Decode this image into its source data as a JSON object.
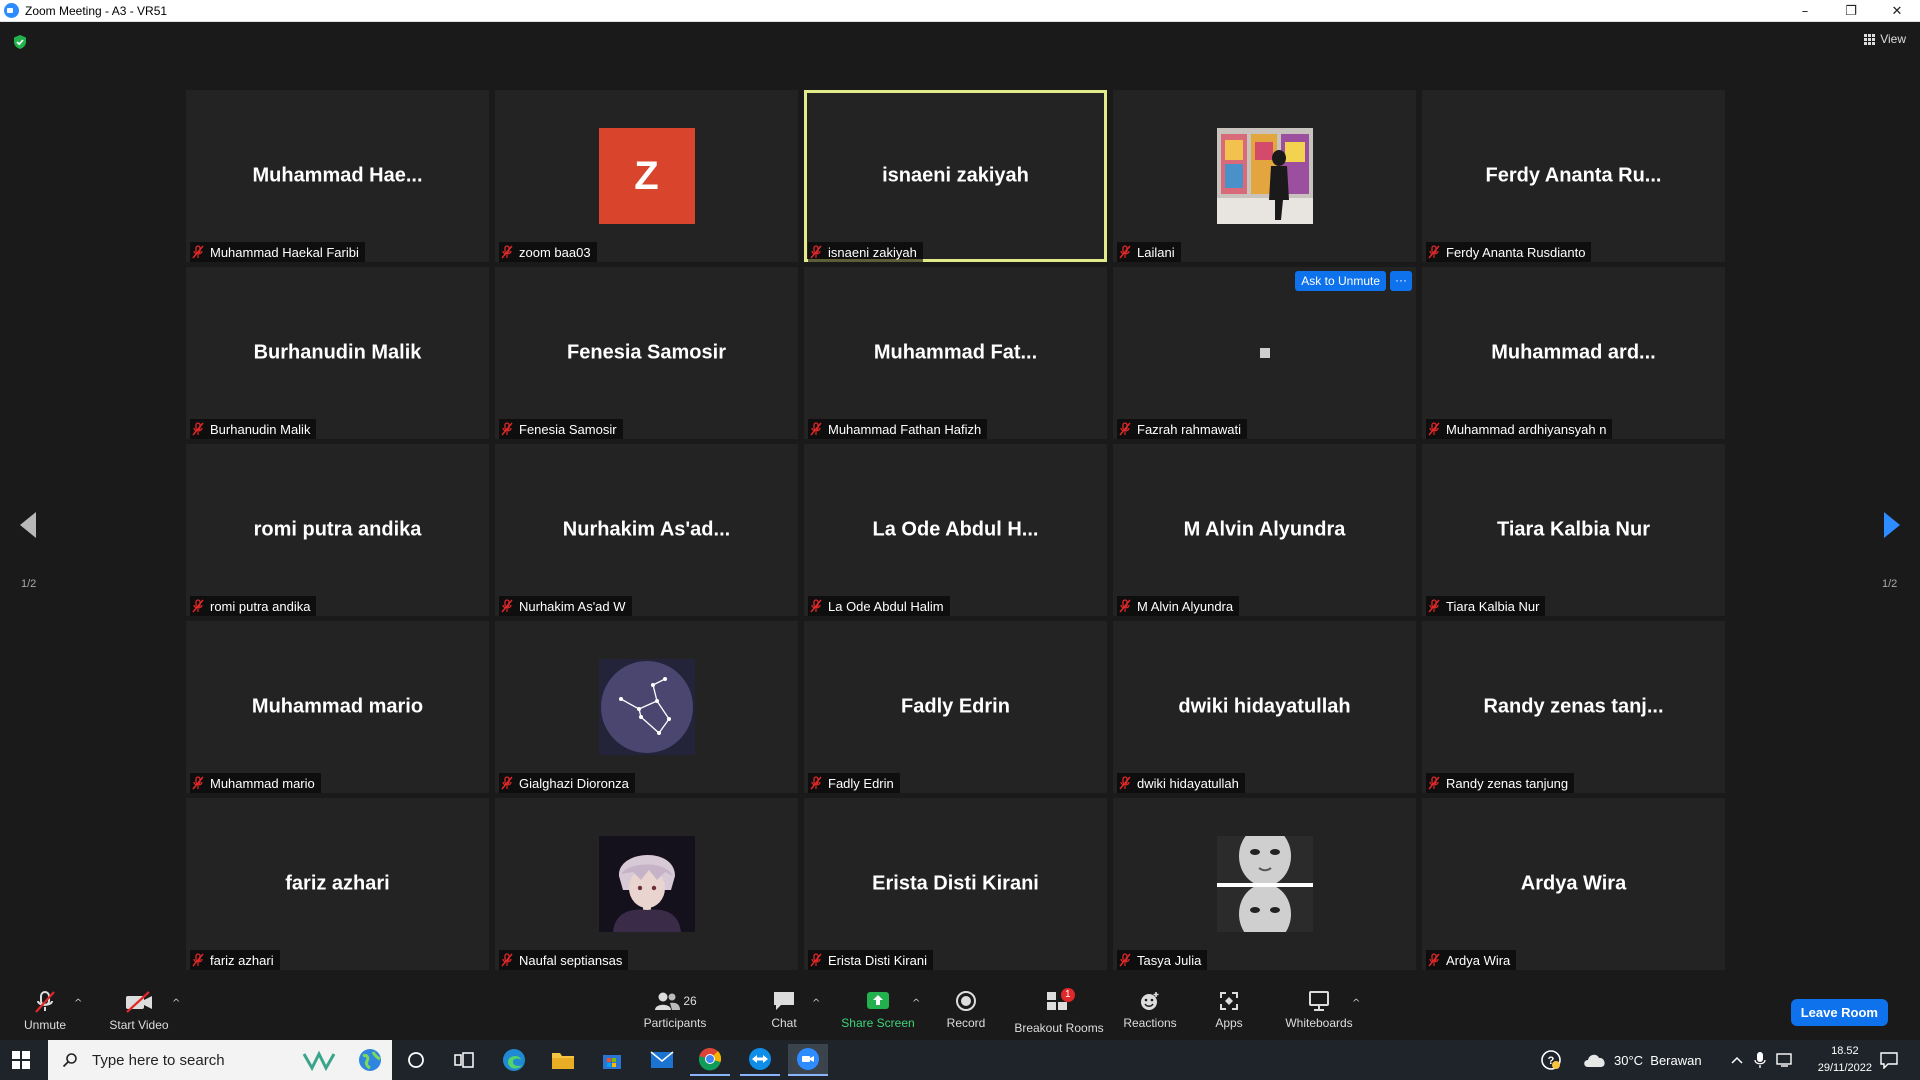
{
  "window": {
    "title": "Zoom Meeting - A3 - VR51",
    "minimize": "–",
    "restore": "❐",
    "close": "✕"
  },
  "view_label": "View",
  "pager": {
    "left": "1/2",
    "right": "1/2"
  },
  "ask_to_unmute": "Ask to Unmute",
  "more": "···",
  "participants": [
    {
      "big": "Muhammad  Hae...",
      "label": "Muhammad Haekal Faribi",
      "kind": "name"
    },
    {
      "big": "Z",
      "label": "zoom baa03",
      "kind": "letter"
    },
    {
      "big": "isnaeni zakiyah",
      "label": "isnaeni zakiyah",
      "kind": "name",
      "active": true
    },
    {
      "big": "",
      "label": "Lailani",
      "kind": "photo-gallery"
    },
    {
      "big": "Ferdy  Ananta  Ru...",
      "label": "Ferdy Ananta Rusdianto",
      "kind": "name"
    },
    {
      "big": "Burhanudin Malik",
      "label": "Burhanudin Malik",
      "kind": "name"
    },
    {
      "big": "Fenesia Samosir",
      "label": "Fenesia Samosir",
      "kind": "name"
    },
    {
      "big": "Muhammad  Fat...",
      "label": "Muhammad Fathan Hafizh",
      "kind": "name"
    },
    {
      "big": "",
      "label": "Fazrah rahmawati",
      "kind": "square",
      "hover": true
    },
    {
      "big": "Muhammad  ard...",
      "label": "Muhammad ardhiyansyah n",
      "kind": "name"
    },
    {
      "big": "romi putra andika",
      "label": "romi putra andika",
      "kind": "name"
    },
    {
      "big": "Nurhakim  As'ad...",
      "label": "Nurhakim As'ad W",
      "kind": "name"
    },
    {
      "big": "La Ode Abdul H...",
      "label": "La Ode Abdul Halim",
      "kind": "name"
    },
    {
      "big": "M Alvin Alyundra",
      "label": "M Alvin Alyundra",
      "kind": "name"
    },
    {
      "big": "Tiara Kalbia Nur",
      "label": "Tiara Kalbia Nur",
      "kind": "name"
    },
    {
      "big": "Muhammad mario",
      "label": "Muhammad mario",
      "kind": "name"
    },
    {
      "big": "",
      "label": "Gialghazi Dioronza",
      "kind": "photo-constellation"
    },
    {
      "big": "Fadly Edrin",
      "label": "Fadly Edrin",
      "kind": "name"
    },
    {
      "big": "dwiki hidayatullah",
      "label": "dwiki hidayatullah",
      "kind": "name"
    },
    {
      "big": "Randy zenas tanj...",
      "label": "Randy zenas tanjung",
      "kind": "name"
    },
    {
      "big": "fariz azhari",
      "label": "fariz azhari",
      "kind": "name"
    },
    {
      "big": "",
      "label": "Naufal septiansas",
      "kind": "photo-anime"
    },
    {
      "big": "Erista Disti Kirani",
      "label": "Erista Disti Kirani",
      "kind": "name"
    },
    {
      "big": "",
      "label": "Tasya Julia",
      "kind": "photo-bw"
    },
    {
      "big": "Ardya Wira",
      "label": "Ardya Wira",
      "kind": "name"
    }
  ],
  "toolbar": {
    "unmute": "Unmute",
    "start_video": "Start Video",
    "participants": "Participants",
    "participants_count": "26",
    "chat": "Chat",
    "share_screen": "Share Screen",
    "record": "Record",
    "breakout_rooms": "Breakout Rooms",
    "breakout_badge": "1",
    "reactions": "Reactions",
    "apps": "Apps",
    "whiteboards": "Whiteboards",
    "caret": "^",
    "leave": "Leave Room"
  },
  "taskbar": {
    "search_placeholder": "Type here to search",
    "weather": "30°C  Berawan",
    "time": "18.52",
    "date": "29/11/2022"
  },
  "colors": {
    "accent": "#0e72ed",
    "active_border": "#e3ea8a",
    "mic_off": "#e02828",
    "share_green": "#3dd37a"
  }
}
